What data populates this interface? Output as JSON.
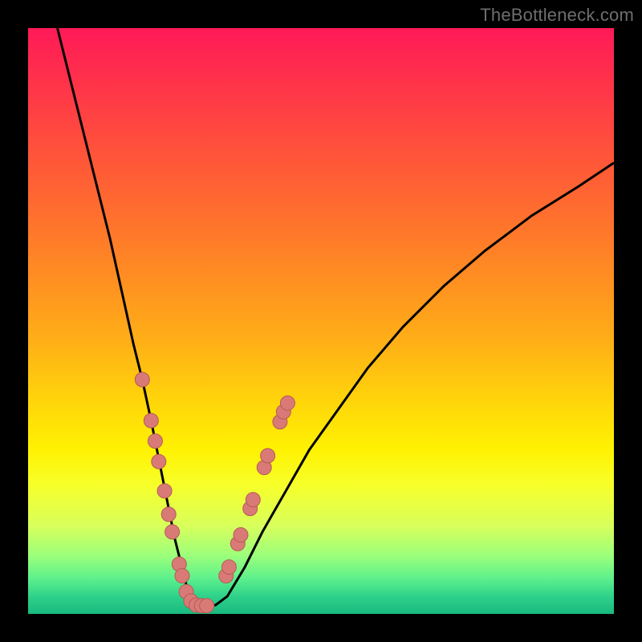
{
  "watermark": "TheBottleneck.com",
  "colors": {
    "background": "#000000",
    "curve_stroke": "#000000",
    "marker_fill": "#d97a76",
    "marker_stroke": "#b55b57",
    "gradient_top": "#ff1a57",
    "gradient_bottom": "#19b97f"
  },
  "chart_data": {
    "type": "line",
    "title": "",
    "xlabel": "",
    "ylabel": "",
    "xlim": [
      0,
      100
    ],
    "ylim": [
      0,
      100
    ],
    "grid": false,
    "legend": false,
    "series": [
      {
        "name": "bottleneck-curve",
        "x": [
          5,
          8,
          11,
          14,
          16,
          18,
          19.5,
          21,
          22,
          23,
          24,
          25,
          26,
          27,
          28,
          29,
          30,
          32,
          34,
          37,
          40,
          44,
          48,
          53,
          58,
          64,
          71,
          78,
          86,
          94,
          100
        ],
        "y": [
          100,
          88,
          76,
          64,
          55,
          46,
          40,
          33,
          28,
          23,
          18,
          13,
          9,
          5,
          2.5,
          1.5,
          1.3,
          1.5,
          3,
          8,
          14,
          21,
          28,
          35,
          42,
          49,
          56,
          62,
          68,
          73,
          77
        ]
      }
    ],
    "markers": [
      {
        "x": 19.5,
        "y": 40
      },
      {
        "x": 21.0,
        "y": 33
      },
      {
        "x": 21.7,
        "y": 29.5
      },
      {
        "x": 22.3,
        "y": 26
      },
      {
        "x": 23.3,
        "y": 21
      },
      {
        "x": 24.0,
        "y": 17
      },
      {
        "x": 24.6,
        "y": 14
      },
      {
        "x": 25.8,
        "y": 8.5
      },
      {
        "x": 26.3,
        "y": 6.5
      },
      {
        "x": 27.0,
        "y": 3.8
      },
      {
        "x": 27.8,
        "y": 2.2
      },
      {
        "x": 28.7,
        "y": 1.5
      },
      {
        "x": 29.6,
        "y": 1.4
      },
      {
        "x": 30.5,
        "y": 1.4
      },
      {
        "x": 33.8,
        "y": 6.5
      },
      {
        "x": 34.3,
        "y": 8.0
      },
      {
        "x": 35.8,
        "y": 12.0
      },
      {
        "x": 36.3,
        "y": 13.5
      },
      {
        "x": 37.9,
        "y": 18.0
      },
      {
        "x": 38.4,
        "y": 19.5
      },
      {
        "x": 40.3,
        "y": 25.0
      },
      {
        "x": 40.9,
        "y": 27.0
      },
      {
        "x": 43.0,
        "y": 32.8
      },
      {
        "x": 43.6,
        "y": 34.5
      },
      {
        "x": 44.3,
        "y": 36.0
      }
    ]
  }
}
